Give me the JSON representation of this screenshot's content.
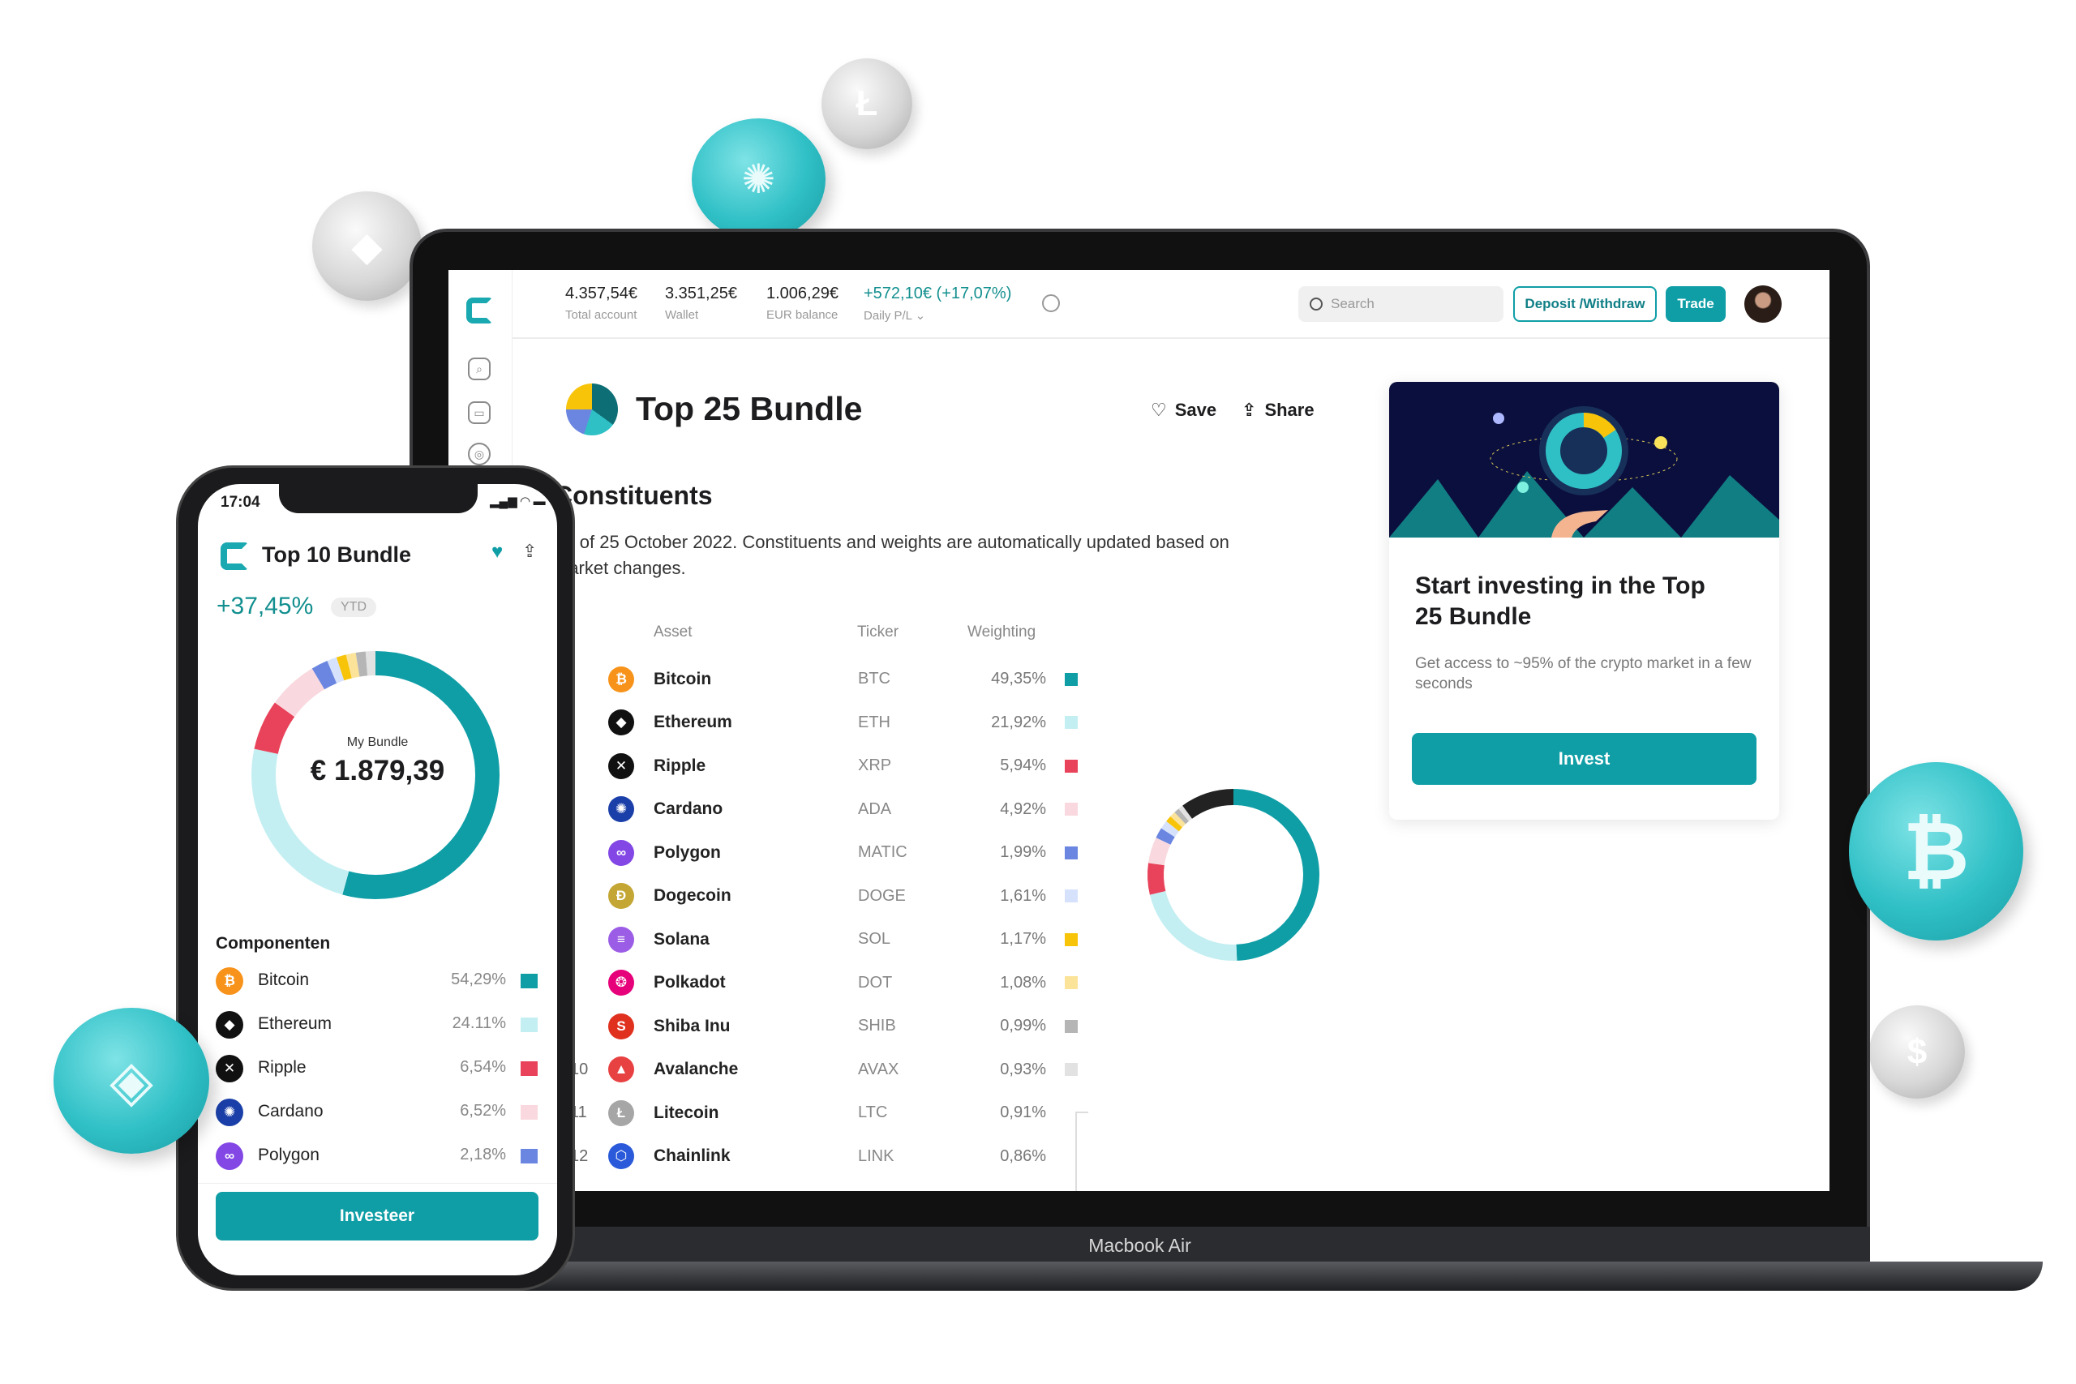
{
  "device_label": "Macbook Air",
  "colors": {
    "accent": "#0f9ea6",
    "positive": "#138f8f"
  },
  "header": {
    "stats": [
      {
        "value": "4.357,54€",
        "label": "Total account"
      },
      {
        "value": "3.351,25€",
        "label": "Wallet"
      },
      {
        "value": "1.006,29€",
        "label": "EUR balance"
      },
      {
        "value": "+572,10€ (+17,07%)",
        "label": "Daily P/L"
      }
    ],
    "search_placeholder": "Search",
    "deposit_label": "Deposit /Withdraw",
    "trade_label": "Trade"
  },
  "sidebar": {
    "icons": [
      "logo-icon",
      "chart-search-icon",
      "wallet-icon",
      "globe-icon"
    ]
  },
  "bundle": {
    "title": "Top 25 Bundle",
    "save_label": "Save",
    "share_label": "Share",
    "section_title": "Constituents",
    "description": "As of 25 October 2022. Constituents and weights are automatically updated based on market changes.",
    "columns": {
      "asset": "Asset",
      "ticker": "Ticker",
      "weighting": "Weighting"
    },
    "rows": [
      {
        "rank": "",
        "asset": "Bitcoin",
        "ticker": "BTC",
        "weight": "49,35%",
        "value": 49.35,
        "color": "#0f9ea6",
        "icon": "bitcoin-icon",
        "glyph": "₿",
        "bg": "#f7931a"
      },
      {
        "rank": "",
        "asset": "Ethereum",
        "ticker": "ETH",
        "weight": "21,92%",
        "value": 21.92,
        "color": "#c4eff2",
        "icon": "ethereum-icon",
        "glyph": "◆",
        "bg": "#111"
      },
      {
        "rank": "",
        "asset": "Ripple",
        "ticker": "XRP",
        "weight": "5,94%",
        "value": 5.94,
        "color": "#e8435a",
        "icon": "ripple-icon",
        "glyph": "✕",
        "bg": "#111"
      },
      {
        "rank": "",
        "asset": "Cardano",
        "ticker": "ADA",
        "weight": "4,92%",
        "value": 4.92,
        "color": "#f9d9df",
        "icon": "cardano-icon",
        "glyph": "✺",
        "bg": "#1a3fa8"
      },
      {
        "rank": "",
        "asset": "Polygon",
        "ticker": "MATIC",
        "weight": "1,99%",
        "value": 1.99,
        "color": "#6a86e0",
        "icon": "polygon-icon",
        "glyph": "∞",
        "bg": "#8247e5"
      },
      {
        "rank": "",
        "asset": "Dogecoin",
        "ticker": "DOGE",
        "weight": "1,61%",
        "value": 1.61,
        "color": "#d6e2fb",
        "icon": "dogecoin-icon",
        "glyph": "Ð",
        "bg": "#c3a634"
      },
      {
        "rank": "",
        "asset": "Solana",
        "ticker": "SOL",
        "weight": "1,17%",
        "value": 1.17,
        "color": "#f7c40a",
        "icon": "solana-icon",
        "glyph": "≡",
        "bg": "#9b5de5"
      },
      {
        "rank": "",
        "asset": "Polkadot",
        "ticker": "DOT",
        "weight": "1,08%",
        "value": 1.08,
        "color": "#fbe39a",
        "icon": "polkadot-icon",
        "glyph": "❂",
        "bg": "#e6007a"
      },
      {
        "rank": "",
        "asset": "Shiba Inu",
        "ticker": "SHIB",
        "weight": "0,99%",
        "value": 0.99,
        "color": "#b5b5b5",
        "icon": "shiba-inu-icon",
        "glyph": "S",
        "bg": "#e0301e"
      },
      {
        "rank": "10",
        "asset": "Avalanche",
        "ticker": "AVAX",
        "weight": "0,93%",
        "value": 0.93,
        "color": "#e2e2e2",
        "icon": "avalanche-icon",
        "glyph": "▲",
        "bg": "#e84142"
      },
      {
        "rank": "11",
        "asset": "Litecoin",
        "ticker": "LTC",
        "weight": "0,91%",
        "value": 0.91,
        "color": "",
        "icon": "litecoin-icon",
        "glyph": "Ł",
        "bg": "#a6a6a6"
      },
      {
        "rank": "12",
        "asset": "Chainlink",
        "ticker": "LINK",
        "weight": "0,86%",
        "value": 0.86,
        "color": "",
        "icon": "chainlink-icon",
        "glyph": "⬡",
        "bg": "#2a5ada"
      }
    ]
  },
  "promo": {
    "title": "Start investing in the Top 25 Bundle",
    "description": "Get access to ~95% of the crypto market in a few seconds",
    "button": "Invest"
  },
  "phone": {
    "time": "17:04",
    "title": "Top 10 Bundle",
    "return": "+37,45%",
    "period": "YTD",
    "donut_label": "My Bundle",
    "donut_value": "€ 1.879,39",
    "section_title": "Componenten",
    "components": [
      {
        "asset": "Bitcoin",
        "weight": "54,29%",
        "value": 54.29,
        "color": "#0f9ea6",
        "glyph": "₿",
        "bg": "#f7931a",
        "icon": "bitcoin-icon"
      },
      {
        "asset": "Ethereum",
        "weight": "24.11%",
        "value": 24.11,
        "color": "#c4eff2",
        "glyph": "◆",
        "bg": "#111",
        "icon": "ethereum-icon"
      },
      {
        "asset": "Ripple",
        "weight": "6,54%",
        "value": 6.54,
        "color": "#e8435a",
        "glyph": "✕",
        "bg": "#111",
        "icon": "ripple-icon"
      },
      {
        "asset": "Cardano",
        "weight": "6,52%",
        "value": 6.52,
        "color": "#f9d9df",
        "glyph": "✺",
        "bg": "#1a3fa8",
        "icon": "cardano-icon"
      },
      {
        "asset": "Polygon",
        "weight": "2,18%",
        "value": 2.18,
        "color": "#6a86e0",
        "glyph": "∞",
        "bg": "#8247e5",
        "icon": "polygon-icon"
      }
    ],
    "button": "Investeer"
  }
}
